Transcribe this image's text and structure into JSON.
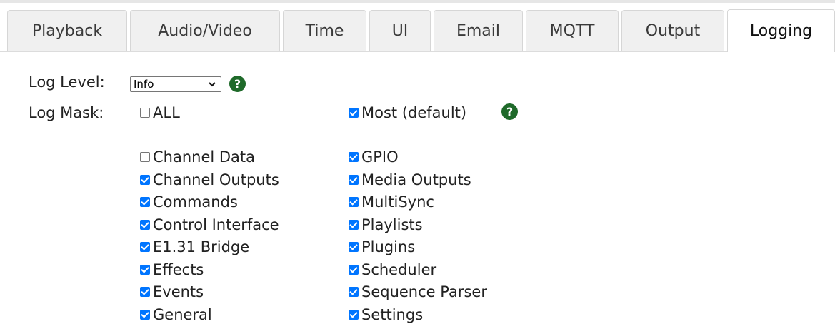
{
  "tabs": [
    {
      "label": "Playback",
      "active": false
    },
    {
      "label": "Audio/Video",
      "active": false
    },
    {
      "label": "Time",
      "active": false
    },
    {
      "label": "UI",
      "active": false
    },
    {
      "label": "Email",
      "active": false
    },
    {
      "label": "MQTT",
      "active": false
    },
    {
      "label": "Output",
      "active": false
    },
    {
      "label": "Logging",
      "active": true
    }
  ],
  "log_level": {
    "label": "Log Level:",
    "selected": "Info",
    "help": "?"
  },
  "log_mask": {
    "label": "Log Mask:",
    "all": {
      "label": "ALL",
      "checked": false
    },
    "most": {
      "label": "Most (default)",
      "checked": true
    },
    "help": "?",
    "left_column": [
      {
        "label": "Channel Data",
        "checked": false
      },
      {
        "label": "Channel Outputs",
        "checked": true
      },
      {
        "label": "Commands",
        "checked": true
      },
      {
        "label": "Control Interface",
        "checked": true
      },
      {
        "label": "E1.31 Bridge",
        "checked": true
      },
      {
        "label": "Effects",
        "checked": true
      },
      {
        "label": "Events",
        "checked": true
      },
      {
        "label": "General",
        "checked": true
      }
    ],
    "right_column": [
      {
        "label": "GPIO",
        "checked": true
      },
      {
        "label": "Media Outputs",
        "checked": true
      },
      {
        "label": "MultiSync",
        "checked": true
      },
      {
        "label": "Playlists",
        "checked": true
      },
      {
        "label": "Plugins",
        "checked": true
      },
      {
        "label": "Scheduler",
        "checked": true
      },
      {
        "label": "Sequence Parser",
        "checked": true
      },
      {
        "label": "Settings",
        "checked": true
      }
    ]
  },
  "colors": {
    "checkbox_checked": "#0075ff",
    "help_icon": "#1f6a2a"
  }
}
